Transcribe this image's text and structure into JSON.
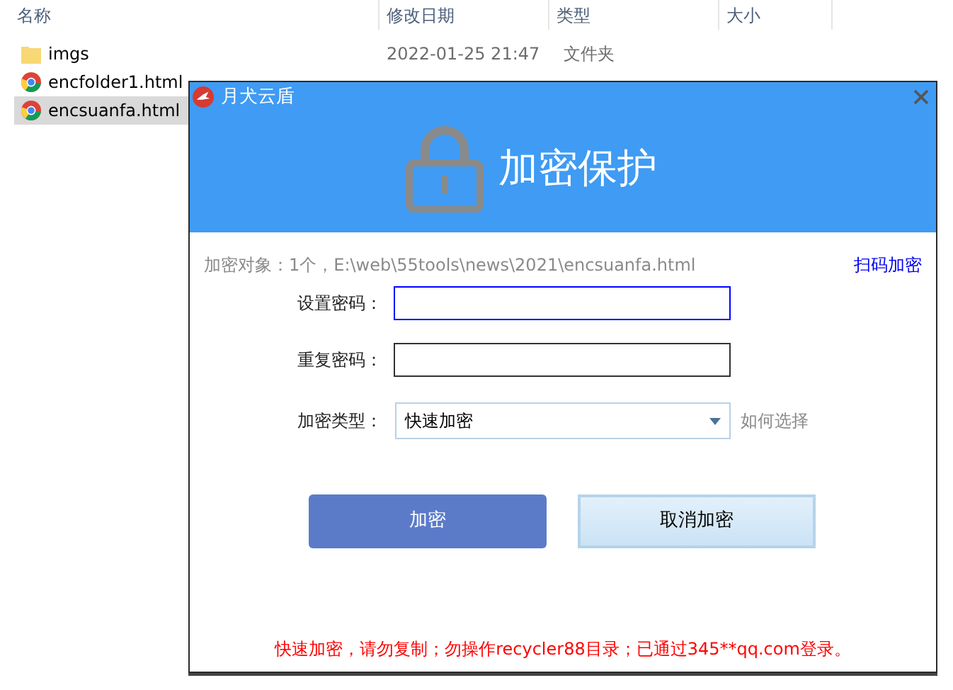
{
  "explorer": {
    "columns": [
      "名称",
      "修改日期",
      "类型",
      "大小"
    ],
    "files": [
      {
        "name": "imgs",
        "kind": "folder",
        "date": "2022-01-25 21:47",
        "type": "文件夹",
        "selected": false
      },
      {
        "name": "encfolder1.html",
        "kind": "chrome",
        "selected": false
      },
      {
        "name": "encsuanfa.html",
        "kind": "chrome",
        "selected": true
      }
    ]
  },
  "dialog": {
    "title": "月犬云盾",
    "heading": "加密保护",
    "target": "加密对象：1个，E:\\web\\55tools\\news\\2021\\encsuanfa.html",
    "scan_link": "扫码加密",
    "fields": [
      {
        "label": "设置密码：",
        "focused": true
      },
      {
        "label": "重复密码：",
        "focused": false
      }
    ],
    "type_label": "加密类型：",
    "type_value": "快速加密",
    "help_link": "如何选择",
    "buttons": [
      {
        "label": "加密",
        "kind": "primary"
      },
      {
        "label": "取消加密",
        "kind": "secondary"
      }
    ],
    "notice": "快速加密，请勿复制；勿操作recycler88目录；已通过345**qq.com登录。"
  }
}
